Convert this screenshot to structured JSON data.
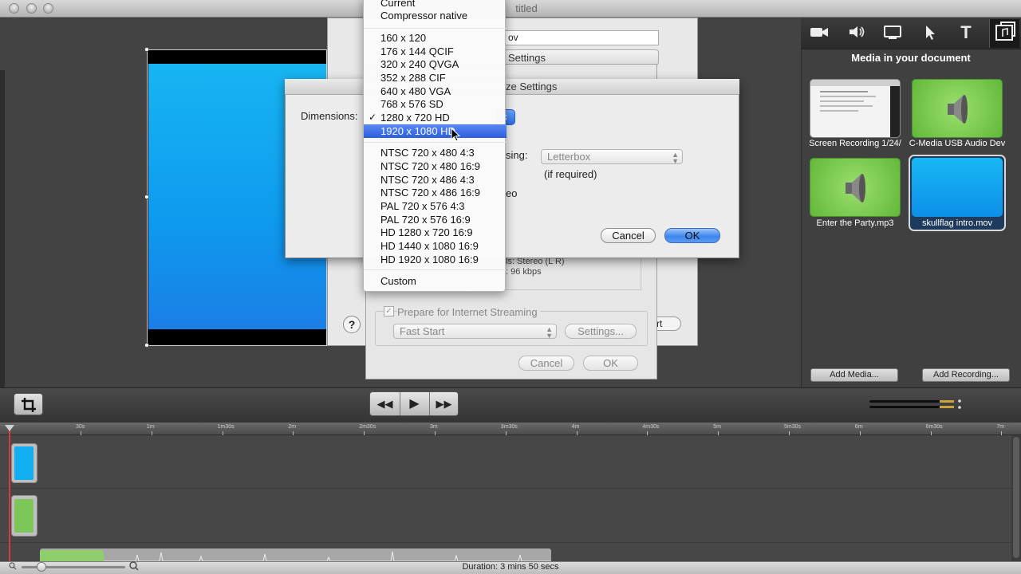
{
  "window": {
    "title": "Untitled",
    "title_fragment": "titled"
  },
  "export_dialog": {
    "filename_fragment": "ov",
    "settings_tab_fragment": "Settings",
    "start_button_fragment": "rt",
    "help_glyph": "?"
  },
  "movie_settings": {
    "sound_line1": "ls: Stereo (L R)",
    "sound_line2": ": 96 kbps",
    "prepare_streaming_label": "Prepare for Internet Streaming",
    "prepare_streaming_checked": true,
    "streaming_option": "Fast Start",
    "settings_button": "Settings...",
    "cancel_button": "Cancel",
    "ok_button": "OK"
  },
  "size_settings": {
    "title_fragment": "ze Settings",
    "dimensions_label": "Dimensions:",
    "scaling_label_fragment": "sing:",
    "scaling_option": "Letterbox",
    "if_required": "(if required)",
    "video_fragment": "eo",
    "cancel_button": "Cancel",
    "ok_button": "OK"
  },
  "dimensions_menu": {
    "group1": [
      "Current",
      "Compressor native"
    ],
    "group2": [
      "160 x 120",
      "176 x 144 QCIF",
      "320 x 240 QVGA",
      "352 x 288 CIF",
      "640 x 480 VGA",
      "768 x 576 SD",
      "1280 x 720 HD",
      "1920 x 1080 HD"
    ],
    "group3": [
      "NTSC 720 x 480 4:3",
      "NTSC 720 x 480 16:9",
      "NTSC 720 x 486 4:3",
      "NTSC 720 x 486 16:9",
      "PAL 720 x 576 4:3",
      "PAL 720 x 576 16:9",
      "HD 1280 x 720 16:9",
      "HD 1440 x 1080 16:9",
      "HD 1920 x 1080 16:9"
    ],
    "group4": [
      "Custom"
    ],
    "checked_item": "1280 x 720 HD",
    "highlighted_item": "1920 x 1080 HD",
    "check_glyph": "✓"
  },
  "right_panel": {
    "heading": "Media in your document",
    "toolbar_icons": [
      "camera-icon",
      "speaker-icon",
      "screen-icon",
      "pointer-icon",
      "text-icon",
      "media-icon"
    ],
    "text_tool_glyph": "T",
    "media": [
      {
        "caption": "Screen Recording 1/24/",
        "kind": "screen"
      },
      {
        "caption": "C-Media USB Audio Dev",
        "kind": "audio"
      },
      {
        "caption": "Enter the Party.mp3",
        "kind": "audio"
      },
      {
        "caption": "skullflag intro.mov",
        "kind": "video"
      }
    ],
    "add_media": "Add Media...",
    "add_recording": "Add Recording..."
  },
  "transport": {
    "rewind_glyph": "◀◀",
    "play_glyph": "▶",
    "forward_glyph": "▶▶",
    "crop_glyph": "⧉"
  },
  "timeline": {
    "ticks": [
      "30s",
      "1m",
      "1m30s",
      "2m",
      "2m30s",
      "3m",
      "3m30s",
      "4m",
      "4m30s",
      "5m",
      "5m30s",
      "6m",
      "6m30s",
      "7m"
    ]
  },
  "status": {
    "duration": "Duration: 3 mins 50 secs"
  },
  "colors": {
    "accent_blue": "#2b5ee0",
    "video_blue": "#12aef0",
    "audio_green": "#7dc65a"
  }
}
